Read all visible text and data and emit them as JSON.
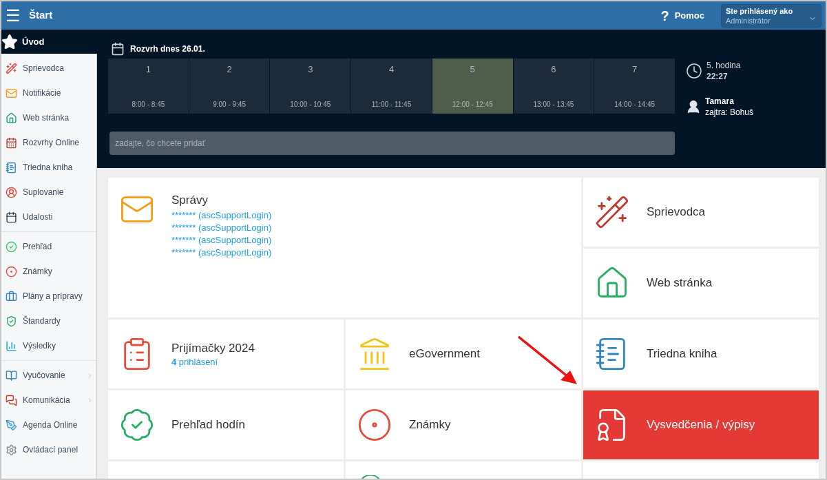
{
  "top_bar": {
    "menu_icon": "☰",
    "title": "Štart",
    "help_icon": "?",
    "help": "Pomoc",
    "user_label": "Ste prihlásený ako",
    "user_role": "Administrátor"
  },
  "sidebar": {
    "home": {
      "label": "Úvod",
      "selected": true
    },
    "groups": [
      [
        {
          "label": "Sprievodca",
          "has_submenu": false
        },
        {
          "label": "Notifikácie",
          "has_submenu": false
        },
        {
          "label": "Web stránka",
          "has_submenu": false
        },
        {
          "label": "Rozvrhy Online",
          "has_submenu": false
        },
        {
          "label": "Triedna kniha",
          "has_submenu": false
        },
        {
          "label": "Suplovanie",
          "has_submenu": false
        },
        {
          "label": "Udalosti",
          "has_submenu": false
        }
      ],
      [
        {
          "label": "Prehľad",
          "has_submenu": false
        },
        {
          "label": "Známky",
          "has_submenu": false
        },
        {
          "label": "Plány a prípravy",
          "has_submenu": false
        },
        {
          "label": "Štandardy",
          "has_submenu": false
        },
        {
          "label": "Výsledky",
          "has_submenu": false
        }
      ],
      [
        {
          "label": "Vyučovanie",
          "has_submenu": true
        },
        {
          "label": "Komunikácia",
          "has_submenu": true
        },
        {
          "label": "Agenda Online",
          "has_submenu": false
        },
        {
          "label": "Ovládací panel",
          "has_submenu": false
        }
      ]
    ]
  },
  "schedule": {
    "title": "Rozvrh dnes 26.01.",
    "periods": [
      {
        "number": "1",
        "time": "8:00 - 8:45",
        "selected": false
      },
      {
        "number": "2",
        "time": "9:00 - 9:45",
        "selected": false
      },
      {
        "number": "3",
        "time": "10:00 - 10:45",
        "selected": false
      },
      {
        "number": "4",
        "time": "11:00 - 11:45",
        "selected": false
      },
      {
        "number": "5",
        "time": "12:00 - 12:45",
        "selected": true
      },
      {
        "number": "6",
        "time": "13:00 - 13:45",
        "selected": false
      },
      {
        "number": "7",
        "time": "14:00 - 14:45",
        "selected": false
      }
    ],
    "current_lesson": "5. hodina",
    "clock": "22:27",
    "duty_name": "Tamara",
    "duty_next": "zajtra: Bohuš",
    "search": {
      "placeholder": "zadajte, čo chcete pridať"
    }
  },
  "tiles": [
    {
      "title": "Správy",
      "lines": [
        "******* (ascSupportLogin)",
        "******* (ascSupportLogin)",
        "******* (ascSupportLogin)",
        "******* (ascSupportLogin)"
      ],
      "selected": false
    },
    {
      "title": "Sprievodca",
      "selected": false
    },
    {
      "title": "Web stránka",
      "selected": false
    },
    {
      "title": "Prijímačky 2024",
      "subtitle": "**4** prihlásení",
      "selected": false
    },
    {
      "title": "eGovernment",
      "selected": false
    },
    {
      "title": "Triedna kniha",
      "selected": false
    },
    {
      "title": "Prehľad hodín",
      "selected": false
    },
    {
      "title": "Známky",
      "selected": false
    },
    {
      "title": "Vysvedčenia / výpisy",
      "selected": true
    }
  ]
}
